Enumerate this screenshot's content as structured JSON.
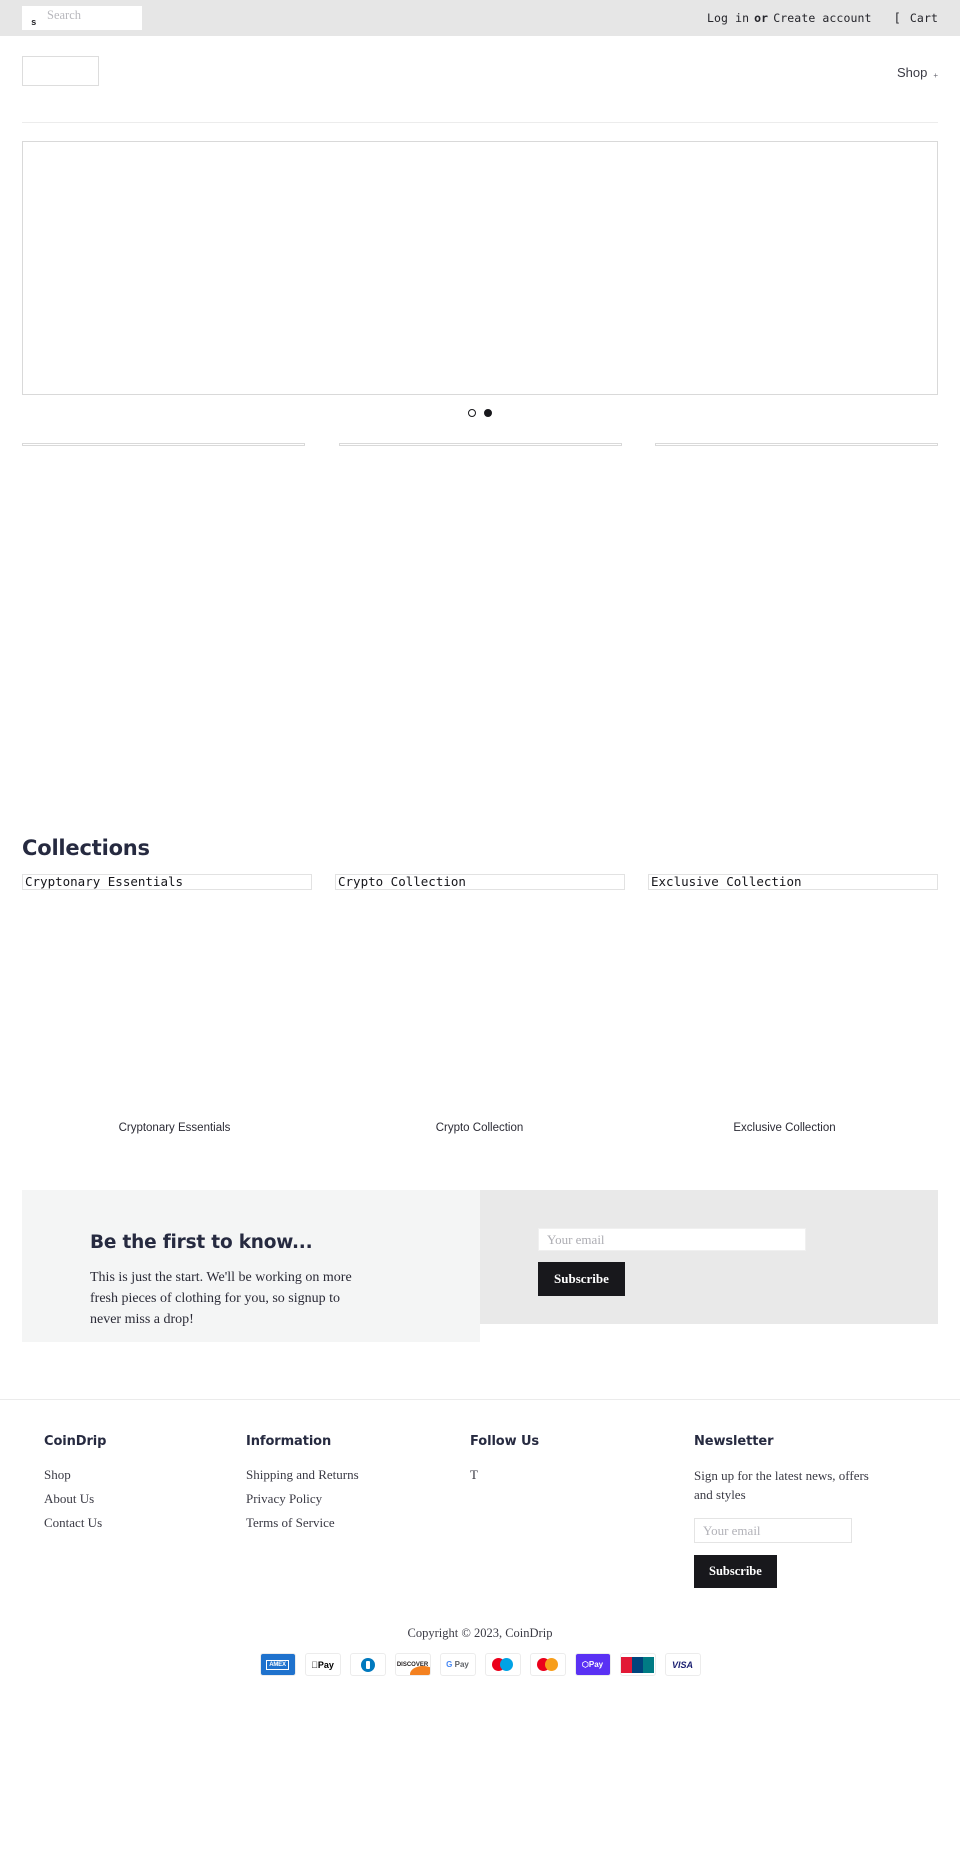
{
  "topbar": {
    "search_glyph": "s",
    "search_placeholder": "Search",
    "search_value": "",
    "login_label": "Log in",
    "or_label": "or",
    "create_account_label": "Create account",
    "cart_icon": "[",
    "cart_label": "Cart"
  },
  "header": {
    "logo_alt": "",
    "nav": [
      {
        "label": "Shop",
        "caret": "+"
      }
    ]
  },
  "hero": {
    "slides": [
      {
        "alt": ""
      },
      {
        "alt": ""
      }
    ],
    "active_index": 1,
    "dot_states": [
      "hollow",
      "filled"
    ]
  },
  "promo_strips": [
    {
      "alt": ""
    },
    {
      "alt": ""
    },
    {
      "alt": ""
    }
  ],
  "collections": {
    "title": "Collections",
    "items": [
      {
        "alt": "Cryptonary Essentials",
        "label": "Cryptonary Essentials"
      },
      {
        "alt": "Crypto Collection",
        "label": "Crypto Collection"
      },
      {
        "alt": "Exclusive Collection",
        "label": "Exclusive Collection"
      }
    ]
  },
  "promo": {
    "heading": "Be the first to know...",
    "body": "This is just the start. We'll be working on more fresh pieces of clothing for you, so signup to never miss a drop!",
    "email_placeholder": "Your email",
    "email_value": "",
    "subscribe_label": "Subscribe"
  },
  "footer": {
    "columns": [
      {
        "heading": "CoinDrip",
        "links": [
          "Shop",
          "About Us",
          "Contact Us"
        ]
      },
      {
        "heading": "Information",
        "links": [
          "Shipping and Returns",
          "Privacy Policy",
          "Terms of Service"
        ]
      }
    ],
    "social": {
      "heading": "Follow Us",
      "items": [
        {
          "icon": "twitter-icon",
          "glyph": "T"
        }
      ]
    },
    "newsletter": {
      "heading": "Newsletter",
      "body": "Sign up for the latest news, offers and styles",
      "email_placeholder": "Your email",
      "email_value": "",
      "subscribe_label": "Subscribe"
    },
    "copyright": "Copyright © 2023, CoinDrip",
    "payment_methods": [
      {
        "name": "american-express",
        "label": "AMEX"
      },
      {
        "name": "apple-pay",
        "label": "Pay"
      },
      {
        "name": "diners-club",
        "label": ""
      },
      {
        "name": "discover",
        "label": "DISCOVER"
      },
      {
        "name": "google-pay",
        "label": "Pay"
      },
      {
        "name": "maestro",
        "label": ""
      },
      {
        "name": "mastercard",
        "label": ""
      },
      {
        "name": "shop-pay",
        "label": "Pay"
      },
      {
        "name": "union-pay",
        "label": "UnionPay"
      },
      {
        "name": "visa",
        "label": "VISA"
      }
    ]
  },
  "colors": {
    "topbar_bg": "#e6e6e6",
    "heading": "#262a40",
    "button_dark": "#18181c",
    "promo_left_bg": "#f4f5f5",
    "promo_right_bg": "#e9e9e9"
  }
}
